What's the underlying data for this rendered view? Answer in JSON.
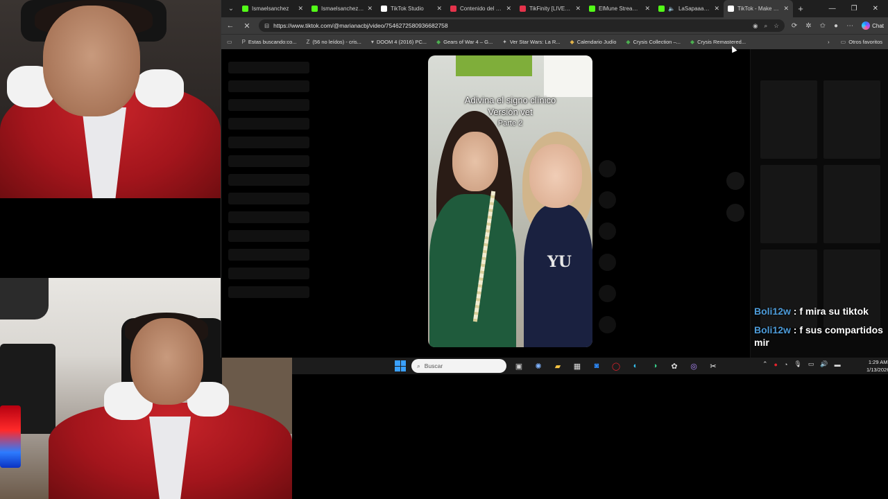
{
  "browser": {
    "tabs": [
      {
        "title": "Ismaelsanchez",
        "color": "#53fc18"
      },
      {
        "title": "Ismaelsanchez18 Ch",
        "color": "#53fc18"
      },
      {
        "title": "TikTok Studio",
        "color": "#ffffff"
      },
      {
        "title": "Contenido del can",
        "color": "#e5334b"
      },
      {
        "title": "TikFinity [LIVE] [9 V",
        "color": "#e5334b"
      },
      {
        "title": "ElMune Stream - Vi",
        "color": "#53fc18"
      },
      {
        "title": "LaSapaaaaa St",
        "color": "#53fc18"
      },
      {
        "title": "TikTok - Make Your",
        "color": "#ffffff"
      }
    ],
    "url": "https://www.tiktok.com/@marianacbj/video/7546272580936682758",
    "bookmarks": [
      {
        "label": "Estas buscando:co...",
        "icon": "P"
      },
      {
        "label": "(56 no leídos) - cris...",
        "icon": "Z"
      },
      {
        "label": "DOOM 4 (2016) PC...",
        "icon": "▾"
      },
      {
        "label": "Gears of War 4 – G...",
        "icon": "◆"
      },
      {
        "label": "Ver Star Wars: La R...",
        "icon": "✦"
      },
      {
        "label": "Calendario Judío",
        "icon": "◆"
      },
      {
        "label": "Crysis Collection –...",
        "icon": "◆"
      },
      {
        "label": "Crysis Remastered...",
        "icon": "◆"
      }
    ],
    "other_bookmarks": "Otros favoritos",
    "chat_label": "Chat"
  },
  "video": {
    "caption_line1": "Adivina el signo clínico",
    "caption_line2": "Versión vet",
    "caption_line3": "Parte 2",
    "hoodie_text": "YU"
  },
  "chat": {
    "messages": [
      {
        "user": "Boli12w",
        "text": " : f mira su tiktok"
      },
      {
        "user": "Boli12w",
        "text": " : f sus compartidos mir"
      }
    ]
  },
  "taskbar": {
    "search_placeholder": "Buscar",
    "time": "1:29 AM",
    "date": "1/13/2026"
  },
  "colors": {
    "chat_user": "#4d9bd8",
    "start_blue": "#3aa0ff"
  }
}
